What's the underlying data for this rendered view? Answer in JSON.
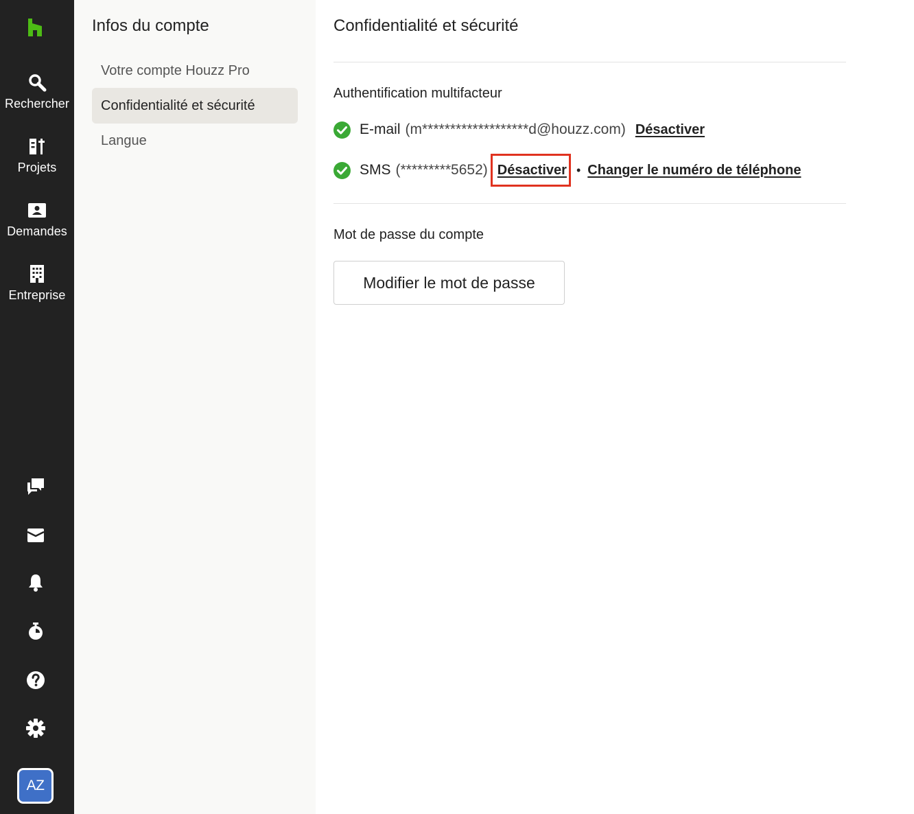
{
  "rail": {
    "items": [
      {
        "label": "Rechercher",
        "icon": "search-icon"
      },
      {
        "label": "Projets",
        "icon": "projects-icon"
      },
      {
        "label": "Demandes",
        "icon": "contact-card-icon"
      },
      {
        "label": "Entreprise",
        "icon": "building-icon"
      }
    ],
    "bottom_icons": [
      "chat-icon",
      "inbox-icon",
      "bell-icon",
      "timer-icon",
      "help-icon",
      "gear-icon"
    ],
    "avatar_initials": "AZ"
  },
  "subnav": {
    "title": "Infos du compte",
    "items": [
      {
        "label": "Votre compte Houzz Pro",
        "active": false
      },
      {
        "label": "Confidentialité et sécurité",
        "active": true
      },
      {
        "label": "Langue",
        "active": false
      }
    ]
  },
  "main": {
    "title": "Confidentialité et sécurité",
    "mfa": {
      "heading": "Authentification multifacteur",
      "email": {
        "method": "E-mail",
        "detail": "(m*******************d@houzz.com)",
        "disable_label": "Désactiver"
      },
      "sms": {
        "method": "SMS",
        "detail": "(*********5652)",
        "disable_label": "Désactiver",
        "separator": "•",
        "change_label": "Changer le numéro de téléphone"
      }
    },
    "password": {
      "heading": "Mot de passe du compte",
      "button_label": "Modifier le mot de passe"
    }
  },
  "colors": {
    "rail_bg": "#222222",
    "subnav_bg": "#f9f9f7",
    "active_item_bg": "#e9e7e2",
    "brand_green": "#4dbc15",
    "check_green": "#3aa935",
    "highlight_red": "#e0321f",
    "avatar_blue": "#3f70c7"
  }
}
